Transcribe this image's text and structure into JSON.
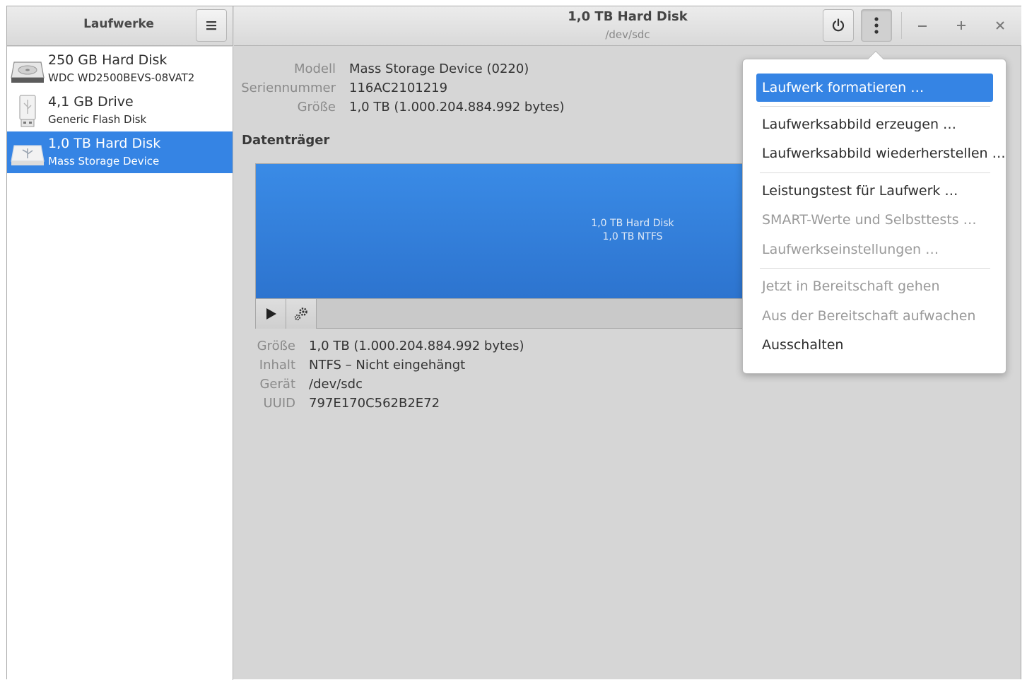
{
  "sidebar": {
    "title": "Laufwerke",
    "drives": [
      {
        "name": "250 GB Hard Disk",
        "desc": "WDC WD2500BEVS-08VAT2",
        "icon": "harddisk-icon"
      },
      {
        "name": "4,1 GB Drive",
        "desc": "Generic Flash Disk",
        "icon": "usb-drive-icon"
      },
      {
        "name": "1,0 TB Hard Disk",
        "desc": "Mass Storage Device",
        "icon": "usb-harddisk-icon",
        "selected": true
      }
    ]
  },
  "header": {
    "title": "1,0 TB Hard Disk",
    "subtitle": "/dev/sdc"
  },
  "details": {
    "model_label": "Modell",
    "model_value": "Mass Storage Device (0220)",
    "serial_label": "Seriennummer",
    "serial_value": "116AC2101219",
    "size_label": "Größe",
    "size_value": "1,0 TB (1.000.204.884.992 bytes)"
  },
  "volumes": {
    "title": "Datenträger",
    "partition_name": "1,0 TB Hard Disk",
    "partition_fs": "1,0 TB NTFS"
  },
  "partition_info": {
    "size_label": "Größe",
    "size_value": "1,0 TB (1.000.204.884.992 bytes)",
    "content_label": "Inhalt",
    "content_value": "NTFS – Nicht eingehängt",
    "device_label": "Gerät",
    "device_value": "/dev/sdc",
    "uuid_label": "UUID",
    "uuid_value": "797E170C562B2E72"
  },
  "menu": {
    "items": [
      {
        "label": "Laufwerk formatieren …",
        "state": "active"
      },
      {
        "label": "Laufwerksabbild erzeugen …",
        "state": "normal"
      },
      {
        "label": "Laufwerksabbild wiederherstellen …",
        "state": "normal"
      },
      {
        "label": "Leistungstest für Laufwerk …",
        "state": "normal"
      },
      {
        "label": "SMART-Werte und Selbsttests …",
        "state": "disabled"
      },
      {
        "label": "Laufwerkseinstellungen …",
        "state": "disabled"
      },
      {
        "label": "Jetzt in Bereitschaft gehen",
        "state": "disabled"
      },
      {
        "label": "Aus der Bereitschaft aufwachen",
        "state": "disabled"
      },
      {
        "label": "Ausschalten",
        "state": "normal"
      }
    ]
  },
  "colors": {
    "accent": "#3584e4",
    "partition": "#3585e0"
  }
}
